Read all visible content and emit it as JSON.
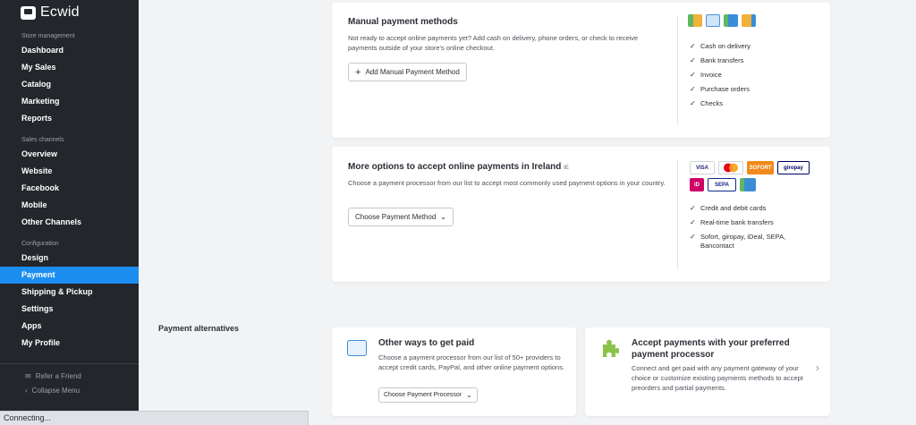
{
  "sidebar": {
    "brand": "Ecwid",
    "sections": [
      {
        "title": "Store management",
        "items": [
          "Dashboard",
          "My Sales",
          "Catalog",
          "Marketing",
          "Reports"
        ]
      },
      {
        "title": "Sales channels",
        "items": [
          "Overview",
          "Website",
          "Facebook",
          "Mobile",
          "Other Channels"
        ]
      },
      {
        "title": "Configuration",
        "items": [
          "Design",
          "Payment",
          "Shipping & Pickup",
          "Settings",
          "Apps",
          "My Profile"
        ]
      }
    ],
    "active": "Payment",
    "refer": "Refer a Friend",
    "collapse": "Collapse Menu"
  },
  "manual": {
    "title": "Manual payment methods",
    "desc": "Not ready to accept online payments yet? Add cash on delivery, phone orders, or check to receive payments outside of your store's online checkout.",
    "button": "Add Manual Payment Method",
    "features": [
      "Cash on delivery",
      "Bank transfers",
      "Invoice",
      "Purchase orders",
      "Checks"
    ]
  },
  "online": {
    "title": "More options to accept online payments in Ireland",
    "flag": "IE",
    "desc": "Choose a payment processor from our list to accept most commonly used payment options in your country.",
    "button": "Choose Payment Method",
    "brands": [
      "VISA",
      "SOFORT",
      "giropay",
      "iD",
      "SEPA"
    ],
    "features": [
      "Credit and debit cards",
      "Real-time bank transfers",
      "Sofort, giropay, iDeal, SEPA, Bancontact"
    ]
  },
  "alternatives": {
    "label": "Payment alternatives",
    "other": {
      "title": "Other ways to get paid",
      "desc": "Choose a payment processor from our list of 50+ providers to accept credit cards, PayPal, and other online payment options.",
      "button": "Choose Payment Processor"
    },
    "preferred": {
      "title": "Accept payments with your preferred payment processor",
      "desc": "Connect and get paid with any payment gateway of your choice or customize existing payments methods to accept preorders and partial payments."
    }
  },
  "status": "Connecting..."
}
